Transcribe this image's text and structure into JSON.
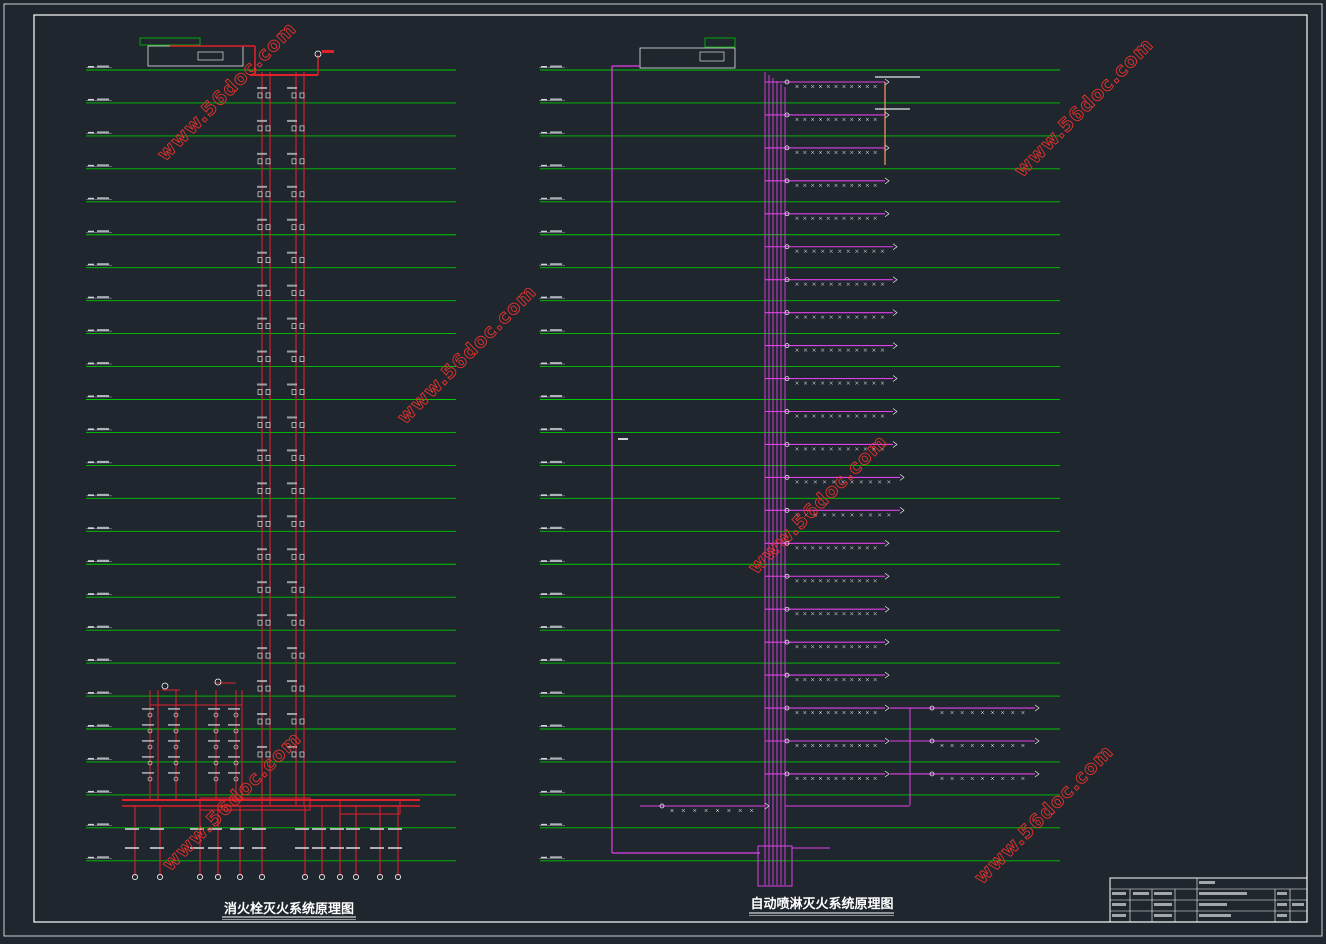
{
  "drawing": {
    "title_left": "消火栓灭火系统原理图",
    "title_right": "自动喷淋灭火系统原理图"
  },
  "watermark": "www.56doc.com",
  "colors": {
    "background": "#1f262e",
    "floor_line": "#00c800",
    "hydrant_pipe": "#e0202a",
    "sprinkler_pipe": "#e040e8",
    "watermark": "#e7332c",
    "border": "#ffffff"
  },
  "floor_count": 25,
  "title_block": {
    "rows": 4,
    "note": "title block text is too small to read"
  }
}
